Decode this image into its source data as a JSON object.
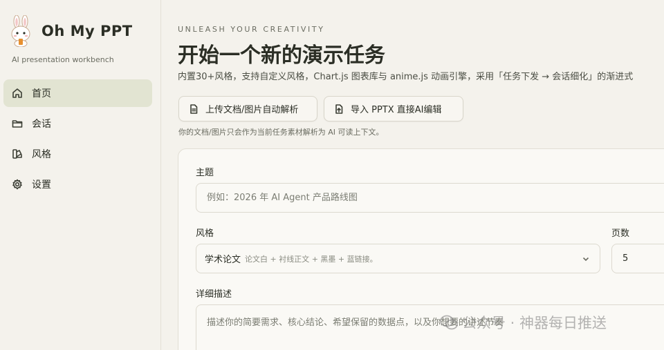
{
  "sidebar": {
    "brand_title": "Oh My PPT",
    "brand_subtitle": "AI presentation workbench",
    "logo_icon": "bunny-mascot",
    "items": [
      {
        "label": "首页",
        "icon": "home-icon",
        "active": true
      },
      {
        "label": "会话",
        "icon": "folder-icon",
        "active": false
      },
      {
        "label": "风格",
        "icon": "palette-icon",
        "active": false
      },
      {
        "label": "设置",
        "icon": "gear-icon",
        "active": false
      }
    ]
  },
  "header": {
    "eyebrow": "UNLEASH YOUR CREATIVITY",
    "title": "开始一个新的演示任务",
    "description": "内置30+风格，支持自定义风格，Chart.js 图表库与 anime.js 动画引擎，采用「任务下发 → 会话细化」的渐进式"
  },
  "actions": {
    "upload_label": "上传文档/图片自动解析",
    "import_label": "导入 PPTX 直接AI编辑",
    "hint": "你的文档/图片只会作为当前任务素材解析为 AI 可读上下文。"
  },
  "form": {
    "topic_label": "主题",
    "topic_placeholder": "例如：2026 年 AI Agent 产品路线图",
    "style_label": "风格",
    "style_value": "学术论文",
    "style_hint": "论文白 + 衬线正文 + 黑墨 + 蓝链接。",
    "pages_label": "页数",
    "pages_value": "5",
    "detail_label": "详细描述",
    "detail_placeholder": "描述你的简要需求、核心结论、希望保留的数据点，以及你想要的讲述节奏"
  },
  "watermark": {
    "text": "公众号 · 神器每日推送"
  },
  "colors": {
    "background": "#f4f2ec",
    "active_nav": "#e2e4d2",
    "card": "#faf9f5",
    "text": "#2b2e25"
  }
}
